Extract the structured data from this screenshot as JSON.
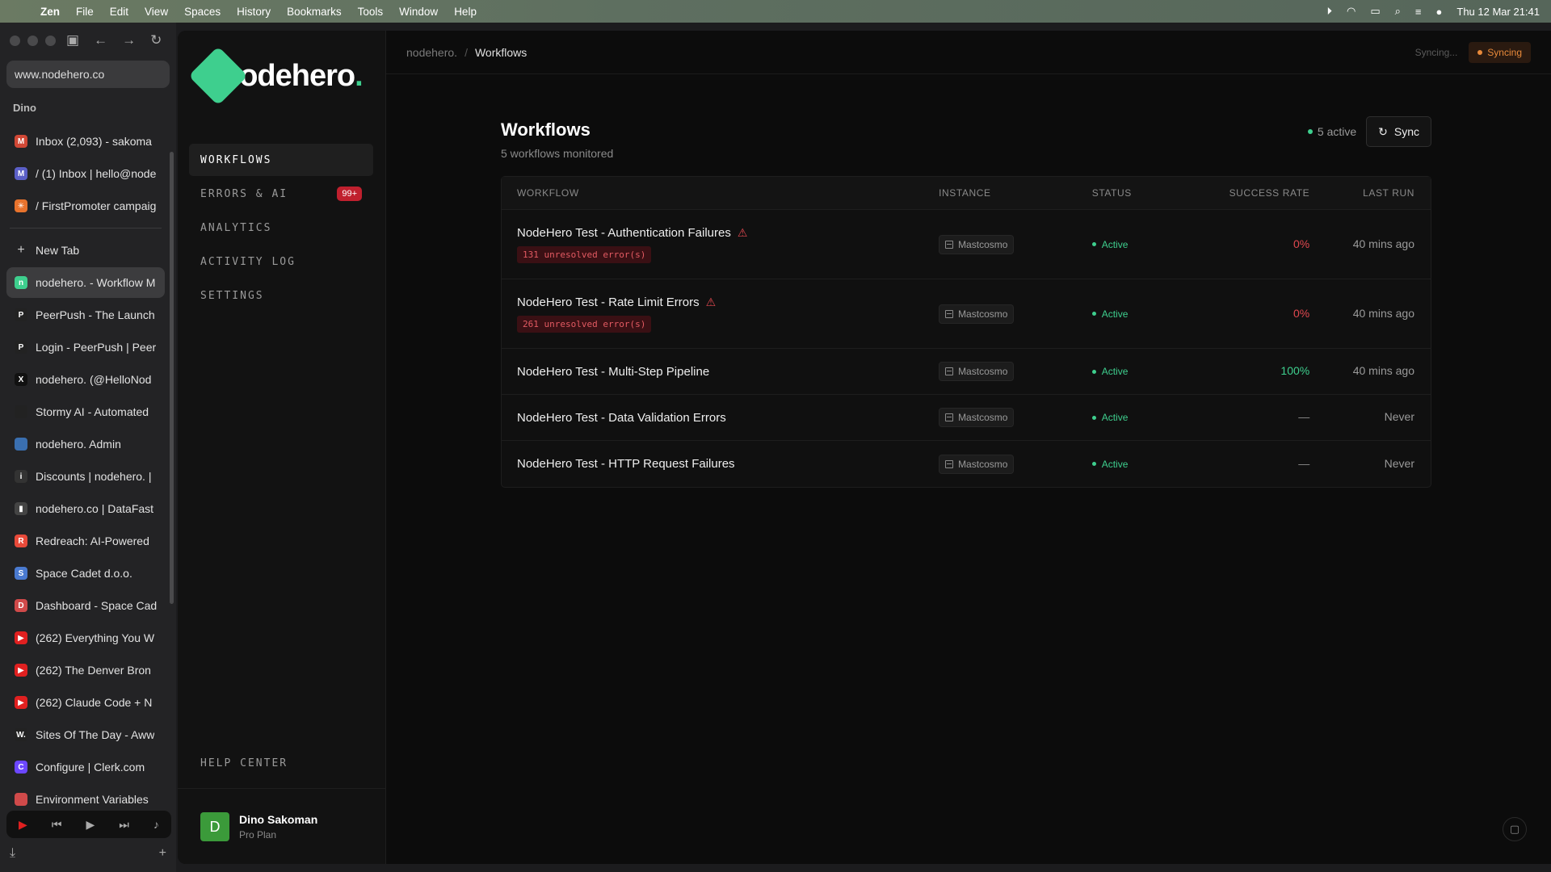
{
  "menubar": {
    "app": "Zen",
    "items": [
      "File",
      "Edit",
      "View",
      "Spaces",
      "History",
      "Bookmarks",
      "Tools",
      "Window",
      "Help"
    ],
    "datetime": "Thu 12 Mar  21:41"
  },
  "browser": {
    "url": "www.nodehero.co",
    "space": "Dino",
    "pinned_tabs": [
      {
        "label": "Inbox (2,093) - sakoma",
        "fav_color": "#d14836",
        "fav": "M"
      },
      {
        "label": "/ (1) Inbox | hello@node",
        "fav_color": "#5b5fc7",
        "fav": "M"
      },
      {
        "label": "/ FirstPromoter campaig",
        "fav_color": "#e8732d",
        "fav": "✳"
      }
    ],
    "new_tab": "New Tab",
    "tabs": [
      {
        "label": "nodehero. - Workflow M",
        "fav_color": "#3ecf8e",
        "fav": "n",
        "active": true
      },
      {
        "label": "PeerPush - The Launch",
        "fav_color": "#222",
        "fav": "P"
      },
      {
        "label": "Login - PeerPush | Peer",
        "fav_color": "#222",
        "fav": "P"
      },
      {
        "label": "nodehero. (@HelloNod",
        "fav_color": "#111",
        "fav": "X"
      },
      {
        "label": "Stormy AI - Automated",
        "fav_color": "#222",
        "fav": ""
      },
      {
        "label": "nodehero. Admin",
        "fav_color": "#3a6fb0",
        "fav": ""
      },
      {
        "label": "Discounts | nodehero. |",
        "fav_color": "#333",
        "fav": "i"
      },
      {
        "label": "nodehero.co | DataFast",
        "fav_color": "#444",
        "fav": "▮"
      },
      {
        "label": "Redreach: AI-Powered",
        "fav_color": "#e84a3a",
        "fav": "R"
      },
      {
        "label": "Space Cadet d.o.o.",
        "fav_color": "#4a7ad0",
        "fav": "S"
      },
      {
        "label": "Dashboard - Space Cad",
        "fav_color": "#d04a4a",
        "fav": "D"
      },
      {
        "label": "(262) Everything You W",
        "fav_color": "#e02020",
        "fav": "▶"
      },
      {
        "label": "(262) The Denver Bron",
        "fav_color": "#e02020",
        "fav": "▶"
      },
      {
        "label": "(262) Claude Code + N",
        "fav_color": "#e02020",
        "fav": "▶"
      },
      {
        "label": "Sites Of The Day - Aww",
        "fav_color": "#222",
        "fav": "W."
      },
      {
        "label": "Configure | Clerk.com",
        "fav_color": "#6c47ff",
        "fav": "C"
      },
      {
        "label": "Environment Variables",
        "fav_color": "#d04a4a",
        "fav": ""
      }
    ]
  },
  "app": {
    "logo_word": "nodehero",
    "logo_dot": ".",
    "nav": [
      {
        "label": "WORKFLOWS",
        "active": true
      },
      {
        "label": "ERRORS & AI",
        "badge": "99+"
      },
      {
        "label": "ANALYTICS"
      },
      {
        "label": "ACTIVITY LOG"
      },
      {
        "label": "SETTINGS"
      }
    ],
    "help_center": "HELP CENTER",
    "user": {
      "initial": "D",
      "name": "Dino Sakoman",
      "plan": "Pro Plan"
    }
  },
  "topbar": {
    "crumb_root": "nodehero.",
    "crumb_sep": "/",
    "crumb_current": "Workflows",
    "syncing_text": "Syncing...",
    "syncing_pill": "Syncing"
  },
  "page": {
    "title": "Workflows",
    "subtitle": "5 workflows monitored",
    "active_count": "5 active",
    "sync_label": "Sync"
  },
  "table": {
    "headers": {
      "workflow": "WORKFLOW",
      "instance": "INSTANCE",
      "status": "STATUS",
      "rate": "SUCCESS RATE",
      "last": "LAST RUN"
    },
    "rows": [
      {
        "name": "NodeHero Test - Authentication Failures",
        "warn": true,
        "errors": "131 unresolved error(s)",
        "instance": "Mastcosmo",
        "status": "Active",
        "rate": "0%",
        "rate_kind": "bad",
        "last": "40 mins ago"
      },
      {
        "name": "NodeHero Test - Rate Limit Errors",
        "warn": true,
        "errors": "261 unresolved error(s)",
        "instance": "Mastcosmo",
        "status": "Active",
        "rate": "0%",
        "rate_kind": "bad",
        "last": "40 mins ago"
      },
      {
        "name": "NodeHero Test - Multi-Step Pipeline",
        "warn": false,
        "errors": "",
        "instance": "Mastcosmo",
        "status": "Active",
        "rate": "100%",
        "rate_kind": "good",
        "last": "40 mins ago"
      },
      {
        "name": "NodeHero Test - Data Validation Errors",
        "warn": false,
        "errors": "",
        "instance": "Mastcosmo",
        "status": "Active",
        "rate": "—",
        "rate_kind": "none",
        "last": "Never"
      },
      {
        "name": "NodeHero Test - HTTP Request Failures",
        "warn": false,
        "errors": "",
        "instance": "Mastcosmo",
        "status": "Active",
        "rate": "—",
        "rate_kind": "none",
        "last": "Never"
      }
    ]
  },
  "colors": {
    "accent": "#3ecf8e",
    "danger": "#e0484f",
    "warning": "#e98a3a"
  }
}
